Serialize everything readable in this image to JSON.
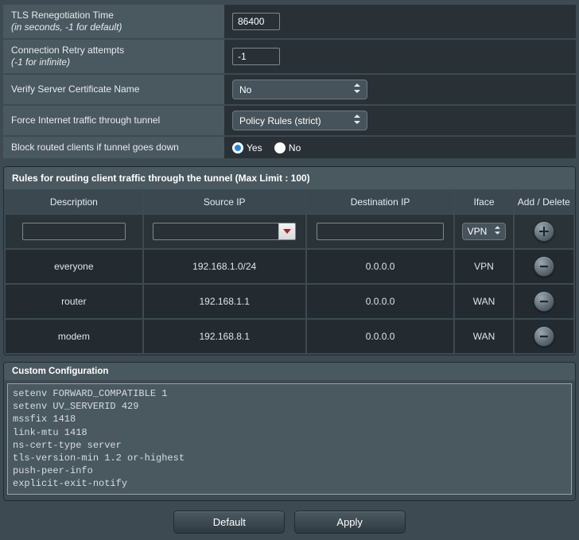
{
  "settings": {
    "tls_reneg": {
      "label": "TLS Renegotiation Time",
      "hint": "(in seconds, -1 for default)",
      "value": "86400"
    },
    "retry": {
      "label": "Connection Retry attempts",
      "hint": "(-1 for infinite)",
      "value": "-1"
    },
    "verify_cn": {
      "label": "Verify Server Certificate Name",
      "value": "No"
    },
    "force_tunnel": {
      "label": "Force Internet traffic through tunnel",
      "value": "Policy Rules (strict)"
    },
    "block_routed": {
      "label": "Block routed clients if tunnel goes down",
      "yes": "Yes",
      "no": "No",
      "selected": "yes"
    }
  },
  "rules": {
    "panel_title": "Rules for routing client traffic through the tunnel (Max Limit : 100)",
    "headers": {
      "desc": "Description",
      "src": "Source IP",
      "dst": "Destination IP",
      "iface": "Iface",
      "act": "Add / Delete"
    },
    "new_row": {
      "iface": "VPN"
    },
    "rows": [
      {
        "desc": "everyone",
        "src": "192.168.1.0/24",
        "dst": "0.0.0.0",
        "iface": "VPN"
      },
      {
        "desc": "router",
        "src": "192.168.1.1",
        "dst": "0.0.0.0",
        "iface": "WAN"
      },
      {
        "desc": "modem",
        "src": "192.168.8.1",
        "dst": "0.0.0.0",
        "iface": "WAN"
      }
    ]
  },
  "custom": {
    "panel_title": "Custom Configuration",
    "text": "setenv FORWARD_COMPATIBLE 1\nsetenv UV_SERVERID 429\nmssfix 1418\nlink-mtu 1418\nns-cert-type server\ntls-version-min 1.2 or-highest\npush-peer-info\nexplicit-exit-notify"
  },
  "buttons": {
    "default": "Default",
    "apply": "Apply"
  }
}
